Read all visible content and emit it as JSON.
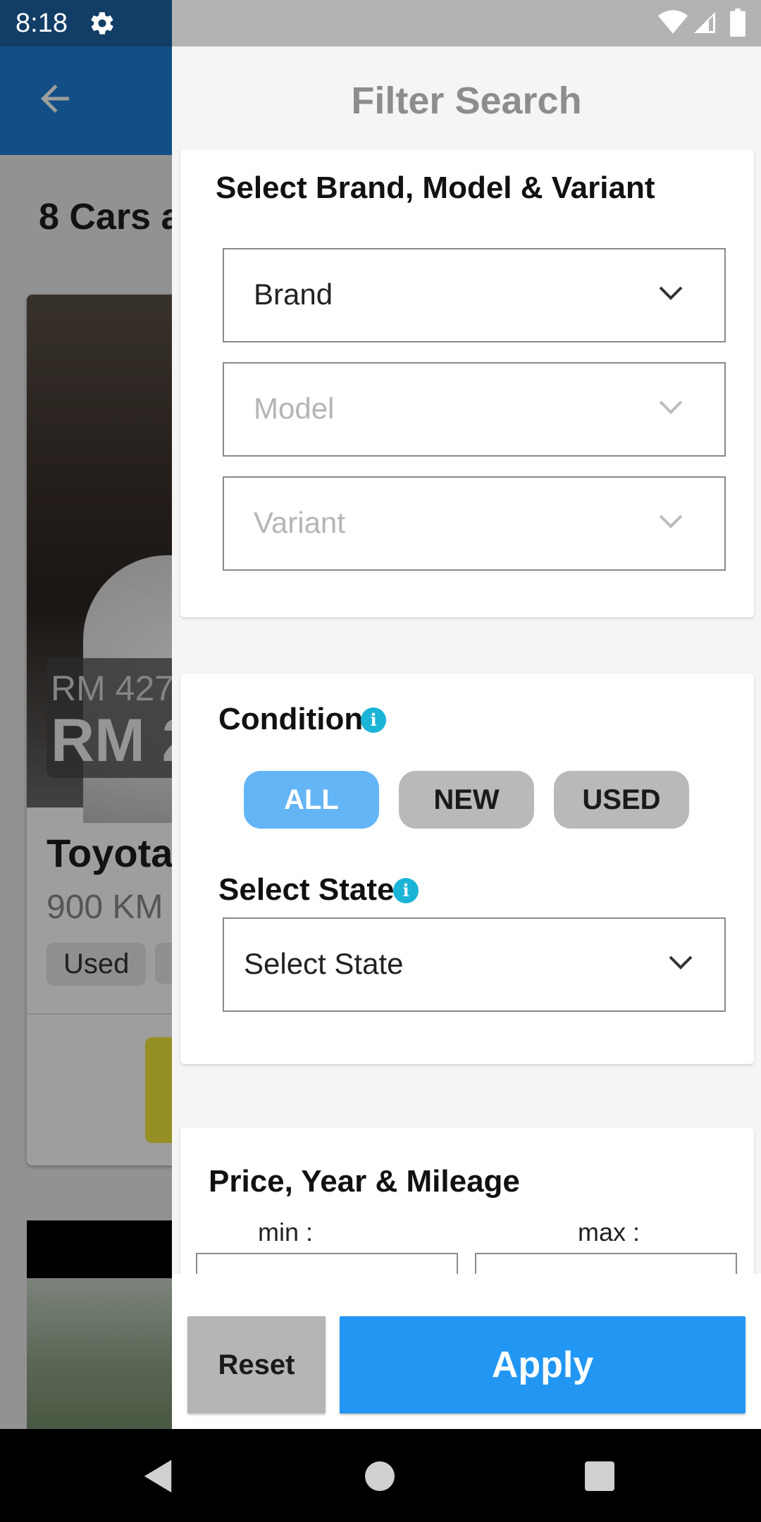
{
  "status_bar": {
    "time": "8:18"
  },
  "background": {
    "results_count": "8 Cars a",
    "listing": {
      "price_old": "RM 427",
      "price_new": "RM 2",
      "title": "Toyota",
      "mileage": "900 KM",
      "tag": "Used"
    }
  },
  "drawer": {
    "title": "Filter Search",
    "brand_section": {
      "title": "Select Brand, Model & Variant",
      "brand_label": "Brand",
      "model_label": "Model",
      "variant_label": "Variant"
    },
    "condition_section": {
      "title": "Condition",
      "options": [
        "ALL",
        "NEW",
        "USED"
      ],
      "selected": "ALL"
    },
    "state_section": {
      "title": "Select State",
      "value": "Select State"
    },
    "price_section": {
      "title": "Price, Year & Mileage",
      "min_label": "min :",
      "max_label": "max :"
    },
    "buttons": {
      "reset": "Reset",
      "apply": "Apply"
    }
  },
  "colors": {
    "accent": "#2196f3",
    "selected_pill": "#64b5f6",
    "info_icon": "#1bb3d6",
    "app_bar": "#1f80d8"
  },
  "icons": {
    "status": [
      "gear-icon",
      "wifi-icon",
      "signal-icon",
      "battery-icon"
    ],
    "nav": [
      "nav-back-icon",
      "nav-home-icon",
      "nav-recents-icon"
    ]
  }
}
